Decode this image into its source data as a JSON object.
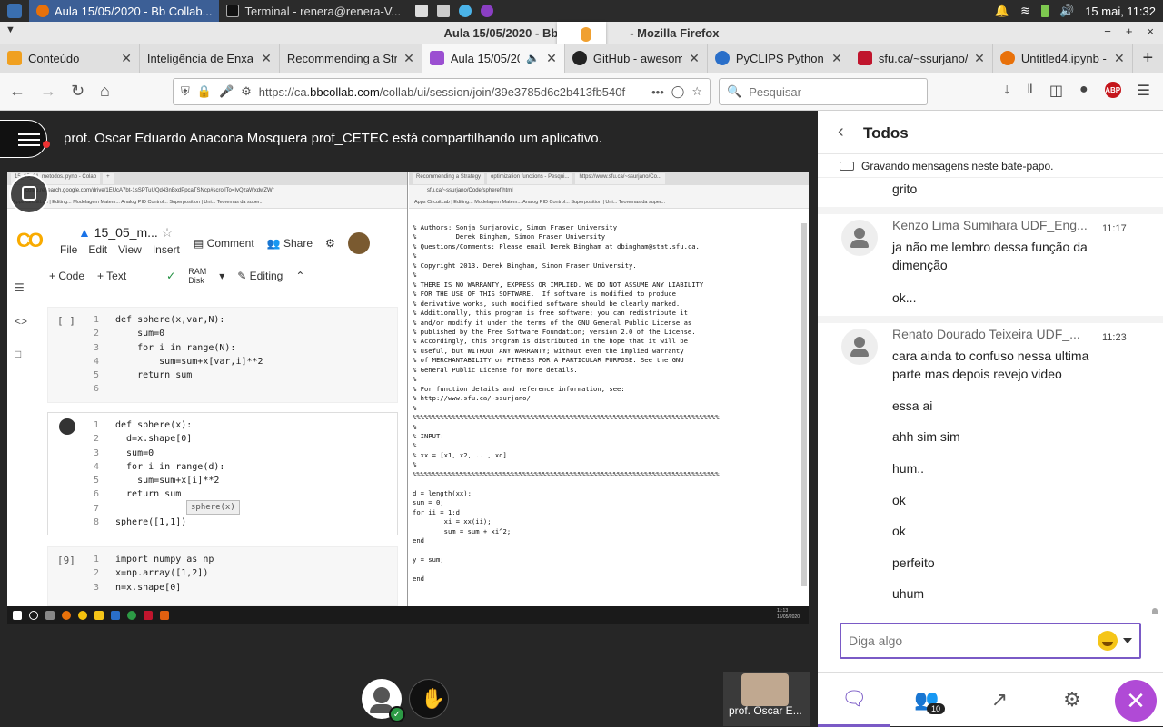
{
  "taskbar": {
    "apps": [
      {
        "label": "Aula 15/05/2020 - Bb Collab...",
        "active": true
      },
      {
        "label": "Terminal - renera@renera-V...",
        "active": false
      }
    ],
    "quick_icons": [
      "folder-icon",
      "settings-icon",
      "app-icon",
      "tor-icon"
    ],
    "clock": "15 mai, 11:32",
    "tray_icons": [
      "bell-icon",
      "wifi-icon",
      "battery-icon",
      "volume-icon"
    ]
  },
  "window": {
    "title": "Aula 15/05/2020 - Bb Co",
    "title_suffix": "- Mozilla Firefox",
    "controls": [
      "−",
      "+",
      "×"
    ]
  },
  "tabs": [
    {
      "label": "Conteúdo",
      "color": "#f0a020"
    },
    {
      "label": "Inteligência de Enxa",
      "color": ""
    },
    {
      "label": "Recommending a Str",
      "color": ""
    },
    {
      "label": "Aula 15/05/20",
      "color": "#9b4fd1",
      "active": true
    },
    {
      "label": "GitHub - awesom",
      "color": "#222222"
    },
    {
      "label": "PyCLIPS Python M",
      "color": "#2a6fc9"
    },
    {
      "label": "sfu.ca/~ssurjano/",
      "color": "#c0152d"
    },
    {
      "label": "Untitled4.ipynb -",
      "color": "#e8710a"
    }
  ],
  "navbar": {
    "url_prefix": "https://ca.",
    "url_domain": "bbcollab.com",
    "url_rest": "/collab/ui/session/join/39e3785d6c2b413fb540f",
    "search_placeholder": "Pesquisar",
    "more": "•••"
  },
  "share": {
    "message": "prof. Oscar Eduardo Anacona Mosquera prof_CETEC está compartilhando um aplicativo."
  },
  "colab": {
    "mini_tabs": [
      "15_05_61_metodos.ipynb - Colab",
      "+"
    ],
    "mini_url": "colab.research.google.com/drive/1EUcA7bt-1sSPTuUQd43nBxdPpcaTSNcp#scrollTo=IvQzaWxdwZWr",
    "bookmarks": "Apps   CircuitLab | Editing...   Modelagem Matem...   Analog PID Control...   Superposition | Uni...   Teoremas da super...",
    "logo": "CO",
    "title": "15_05_m...",
    "menu": [
      "File",
      "Edit",
      "View",
      "Insert"
    ],
    "comment": "Comment",
    "share": "Share",
    "add_code": "+ Code",
    "add_text": "+ Text",
    "ram": "RAM",
    "disk": "Disk",
    "editing": "Editing",
    "cell1_gutter": "[ ]",
    "cell2_gutter": "",
    "cell3_gutter": "[9]",
    "tooltip": "sphere(x)"
  },
  "code_cell1": [
    [
      "1",
      "def sphere(x,var,N):"
    ],
    [
      "2",
      "    sum=0"
    ],
    [
      "3",
      "    for i in range(N):"
    ],
    [
      "4",
      "        sum=sum+x[var,i]**2"
    ],
    [
      "5",
      "    return sum"
    ],
    [
      "6",
      ""
    ]
  ],
  "code_cell2": [
    [
      "1",
      "def sphere(x):"
    ],
    [
      "2",
      "  d=x.shape[0]"
    ],
    [
      "3",
      "  sum=0"
    ],
    [
      "4",
      "  for i in range(d):"
    ],
    [
      "5",
      "    sum=sum+x[i]**2"
    ],
    [
      "6",
      "  return sum"
    ],
    [
      "7",
      ""
    ],
    [
      "8",
      "sphere([1,1])"
    ]
  ],
  "code_cell3": [
    [
      "1",
      "import numpy as np"
    ],
    [
      "2",
      "x=np.array([1,2])"
    ],
    [
      "3",
      "n=x.shape[0]"
    ]
  ],
  "sfu": {
    "mini_tabs": [
      "Recommending a Strategy",
      "optimization functions - Pesqui...",
      "https://www.sfu.ca/~ssurjano/Co..."
    ],
    "mini_url": "sfu.ca/~ssurjano/Code/spheref.html",
    "bookmarks": "Apps   CircuitLab | Editing...   Modelagem Matem...   Analog PID Control...   Superposition | Uni...   Teoremas da super...",
    "source": "% Authors: Sonja Surjanovic, Simon Fraser University\n%          Derek Bingham, Simon Fraser University\n% Questions/Comments: Please email Derek Bingham at dbingham@stat.sfu.ca.\n%\n% Copyright 2013. Derek Bingham, Simon Fraser University.\n%\n% THERE IS NO WARRANTY, EXPRESS OR IMPLIED. WE DO NOT ASSUME ANY LIABILITY\n% FOR THE USE OF THIS SOFTWARE.  If software is modified to produce\n% derivative works, such modified software should be clearly marked.\n% Additionally, this program is free software; you can redistribute it\n% and/or modify it under the terms of the GNU General Public License as\n% published by the Free Software Foundation; version 2.0 of the License.\n% Accordingly, this program is distributed in the hope that it will be\n% useful, but WITHOUT ANY WARRANTY; without even the implied warranty\n% of MERCHANTABILITY or FITNESS FOR A PARTICULAR PURPOSE. See the GNU\n% General Public License for more details.\n%\n% For function details and reference information, see:\n% http://www.sfu.ca/~ssurjano/\n%\n%%%%%%%%%%%%%%%%%%%%%%%%%%%%%%%%%%%%%%%%%%%%%%%%%%%%%%%%%%%%%%%%%%%%%%%%%%%%%%\n%\n% INPUT:\n%\n% xx = [x1, x2, ..., xd]\n%\n%%%%%%%%%%%%%%%%%%%%%%%%%%%%%%%%%%%%%%%%%%%%%%%%%%%%%%%%%%%%%%%%%%%%%%%%%%%%%%\n\nd = length(xx);\nsum = 0;\nfor ii = 1:d\n        xi = xx(ii);\n        sum = sum + xi^2;\nend\n\ny = sum;\n\nend"
  },
  "win_clock": {
    "time": "11:13",
    "date": "15/05/2020"
  },
  "presenter": {
    "name": "prof. Oscar E..."
  },
  "chat": {
    "title": "Todos",
    "recording": "Gravando mensagens neste bate-papo.",
    "first_msg": "grito",
    "group1": {
      "author": "Kenzo Lima Sumihara UDF_Eng...",
      "time": "11:17",
      "messages": [
        "ja não me lembro dessa função da dimenção",
        "ok..."
      ]
    },
    "group2": {
      "author": "Renato Dourado Teixeira UDF_...",
      "time": "11:23",
      "messages": [
        "cara ainda to confuso nessa ultima parte mas depois revejo video",
        "essa ai",
        "ahh sim sim",
        "hum..",
        "ok",
        "ok",
        "perfeito",
        "uhum"
      ]
    },
    "input_placeholder": "Diga algo",
    "attendee_count": "10"
  }
}
